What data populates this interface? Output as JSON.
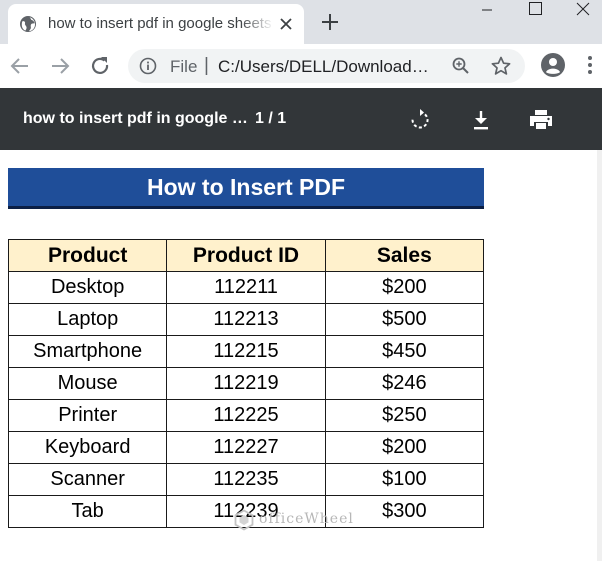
{
  "browser": {
    "tab": {
      "title": "how to insert pdf in google sheets"
    },
    "window_controls": [
      "minimize",
      "maximize",
      "close"
    ],
    "address_bar": {
      "scheme_label": "File",
      "separator": "|",
      "url": "C:/Users/DELL/Downloads/how to insert pdf in google sheets.pdf"
    }
  },
  "pdf_viewer": {
    "title": "how to insert pdf in google sheets",
    "page_indicator": "1 / 1"
  },
  "document": {
    "heading": "How to Insert PDF",
    "table": {
      "headers": [
        "Product",
        "Product ID",
        "Sales"
      ],
      "rows": [
        [
          "Desktop",
          "112211",
          "$200"
        ],
        [
          "Laptop",
          "112213",
          "$500"
        ],
        [
          "Smartphone",
          "112215",
          "$450"
        ],
        [
          "Mouse",
          "112219",
          "$246"
        ],
        [
          "Printer",
          "112225",
          "$250"
        ],
        [
          "Keyboard",
          "112227",
          "$200"
        ],
        [
          "Scanner",
          "112235",
          "$100"
        ],
        [
          "Tab",
          "112239",
          "$300"
        ]
      ]
    },
    "watermark": "officeWheel"
  },
  "colors": {
    "tabbar_bg": "#dee1e6",
    "pdf_toolbar_bg": "#323639",
    "heading_bg": "#1f4e99",
    "table_header_bg": "#fff1cc"
  }
}
